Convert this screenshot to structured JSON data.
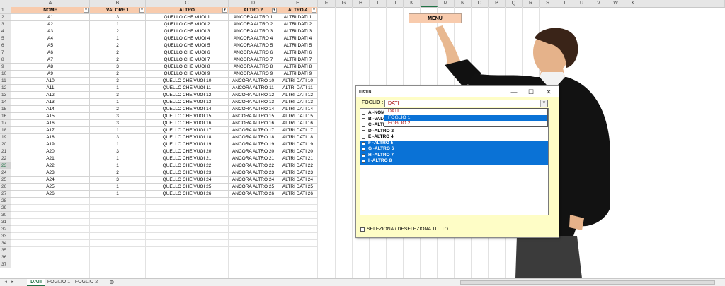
{
  "columns": [
    "A",
    "B",
    "C",
    "D",
    "E",
    "F",
    "G",
    "H",
    "I",
    "J",
    "K",
    "L",
    "M",
    "N",
    "O",
    "P",
    "Q",
    "R",
    "S",
    "T",
    "U",
    "V",
    "W",
    "X"
  ],
  "selected_column": "L",
  "selected_row": "23",
  "table": {
    "headers": [
      "NOME",
      "VALORE 1",
      "ALTRO",
      "ALTRO 2",
      "ALTRO 4"
    ],
    "rows": [
      [
        "A1",
        "3",
        "QUELLO CHE VUOI 1",
        "ANCORA ALTRO 1",
        "ALTRI DATI 1"
      ],
      [
        "A2",
        "1",
        "QUELLO CHE VUOI 2",
        "ANCORA ALTRO 2",
        "ALTRI DATI 2"
      ],
      [
        "A3",
        "2",
        "QUELLO CHE VUOI 3",
        "ANCORA ALTRO 3",
        "ALTRI DATI 3"
      ],
      [
        "A4",
        "1",
        "QUELLO CHE VUOI 4",
        "ANCORA ALTRO 4",
        "ALTRI DATI 4"
      ],
      [
        "A5",
        "2",
        "QUELLO CHE VUOI 5",
        "ANCORA ALTRO 5",
        "ALTRI DATI 5"
      ],
      [
        "A6",
        "2",
        "QUELLO CHE VUOI 6",
        "ANCORA ALTRO 6",
        "ALTRI DATI 6"
      ],
      [
        "A7",
        "2",
        "QUELLO CHE VUOI 7",
        "ANCORA ALTRO 7",
        "ALTRI DATI 7"
      ],
      [
        "A8",
        "3",
        "QUELLO CHE VUOI 8",
        "ANCORA ALTRO 8",
        "ALTRI DATI 8"
      ],
      [
        "A9",
        "2",
        "QUELLO CHE VUOI 9",
        "ANCORA ALTRO 9",
        "ALTRI DATI 9"
      ],
      [
        "A10",
        "3",
        "QUELLO CHE VUOI 10",
        "ANCORA ALTRO 10",
        "ALTRI DATI 10"
      ],
      [
        "A11",
        "1",
        "QUELLO CHE VUOI 11",
        "ANCORA ALTRO 11",
        "ALTRI DATI 11"
      ],
      [
        "A12",
        "3",
        "QUELLO CHE VUOI 12",
        "ANCORA ALTRO 12",
        "ALTRI DATI 12"
      ],
      [
        "A13",
        "1",
        "QUELLO CHE VUOI 13",
        "ANCORA ALTRO 13",
        "ALTRI DATI 13"
      ],
      [
        "A14",
        "2",
        "QUELLO CHE VUOI 14",
        "ANCORA ALTRO 14",
        "ALTRI DATI 14"
      ],
      [
        "A15",
        "3",
        "QUELLO CHE VUOI 15",
        "ANCORA ALTRO 15",
        "ALTRI DATI 15"
      ],
      [
        "A16",
        "3",
        "QUELLO CHE VUOI 16",
        "ANCORA ALTRO 16",
        "ALTRI DATI 16"
      ],
      [
        "A17",
        "1",
        "QUELLO CHE VUOI 17",
        "ANCORA ALTRO 17",
        "ALTRI DATI 17"
      ],
      [
        "A18",
        "3",
        "QUELLO CHE VUOI 18",
        "ANCORA ALTRO 18",
        "ALTRI DATI 18"
      ],
      [
        "A19",
        "1",
        "QUELLO CHE VUOI 19",
        "ANCORA ALTRO 19",
        "ALTRI DATI 19"
      ],
      [
        "A20",
        "3",
        "QUELLO CHE VUOI 20",
        "ANCORA ALTRO 20",
        "ALTRI DATI 20"
      ],
      [
        "A21",
        "1",
        "QUELLO CHE VUOI 21",
        "ANCORA ALTRO 21",
        "ALTRI DATI 21"
      ],
      [
        "A22",
        "1",
        "QUELLO CHE VUOI 22",
        "ANCORA ALTRO 22",
        "ALTRI DATI 22"
      ],
      [
        "A23",
        "2",
        "QUELLO CHE VUOI 23",
        "ANCORA ALTRO 23",
        "ALTRI DATI 23"
      ],
      [
        "A24",
        "3",
        "QUELLO CHE VUOI 24",
        "ANCORA ALTRO 24",
        "ALTRI DATI 24"
      ],
      [
        "A25",
        "1",
        "QUELLO CHE VUOI 25",
        "ANCORA ALTRO 25",
        "ALTRI DATI 25"
      ],
      [
        "A26",
        "1",
        "QUELLO CHE VUOI 26",
        "ANCORA ALTRO 26",
        "ALTRI DATI 26"
      ]
    ]
  },
  "row_numbers": [
    "1",
    "2",
    "3",
    "4",
    "5",
    "6",
    "7",
    "8",
    "9",
    "10",
    "11",
    "12",
    "13",
    "14",
    "15",
    "16",
    "17",
    "18",
    "19",
    "20",
    "21",
    "22",
    "23",
    "24",
    "25",
    "26",
    "27",
    "28",
    "29",
    "30",
    "31",
    "32",
    "33",
    "34",
    "35",
    "36",
    "37"
  ],
  "menu_button_label": "MENU",
  "dialog": {
    "title": "menu",
    "minimize": "—",
    "maximize": "☐",
    "close": "✕",
    "foglio_label": "FOGLIO :",
    "combo_value": "DATI",
    "dropdown_options": [
      "DATI",
      "FOGLIO 1",
      "FOGLIO 2"
    ],
    "dropdown_selected": "FOGLIO 1",
    "list_items": [
      {
        "text": "A  -NOME",
        "selected": false
      },
      {
        "text": "B  -VALORE 1",
        "selected": false
      },
      {
        "text": "C  -ALTRO",
        "selected": false
      },
      {
        "text": "D  -ALTRO 2",
        "selected": false
      },
      {
        "text": "E  -ALTRO 4",
        "selected": false
      },
      {
        "text": "F  -ALTRO 5",
        "selected": true
      },
      {
        "text": "G  -ALTRO 6",
        "selected": true
      },
      {
        "text": "H  -ALTRO 7",
        "selected": true
      },
      {
        "text": "I  -ALTRO 8",
        "selected": true
      }
    ],
    "select_all_label": "SELEZIONA / DESELEZIONA TUTTO"
  },
  "sheet_tabs": [
    {
      "label": "DATI",
      "active": true
    },
    {
      "label": "FOGLIO 1",
      "active": false
    },
    {
      "label": "FOGLIO 2",
      "active": false
    }
  ],
  "add_sheet_icon": "plus-circle-icon",
  "colors": {
    "header_fill": "#f8cbad",
    "dialog_fill": "#fefdc6",
    "selection": "#0a72d6",
    "excel_green": "#217346"
  }
}
